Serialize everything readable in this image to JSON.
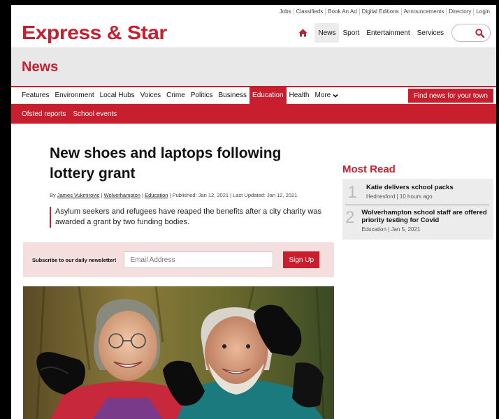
{
  "utility_links": [
    "Jobs",
    "Classifieds",
    "Book An Ad",
    "Digital Editions",
    "Announcements",
    "Directory",
    "Login"
  ],
  "brand": {
    "logo": "Express & Star",
    "accent": "#c91e2e"
  },
  "main_nav": {
    "items": [
      "News",
      "Sport",
      "Entertainment",
      "Services"
    ],
    "active": "News",
    "home_icon": "home-icon",
    "search_icon": "search-icon"
  },
  "section": {
    "title": "News"
  },
  "categories": {
    "items": [
      "Features",
      "Environment",
      "Local Hubs",
      "Voices",
      "Crime",
      "Politics",
      "Business",
      "Education",
      "Health",
      "More"
    ],
    "active": "Education",
    "find_button": "Find news for your town"
  },
  "subnav": [
    "Ofsted reports",
    "School events"
  ],
  "article": {
    "headline": "New shoes and laptops following lottery grant",
    "by": "By",
    "author": "James Vukmirovic",
    "location": "Wolverhampton",
    "category": "Education",
    "published": "Published: Jan 12, 2021",
    "updated": "Last Updated: Jan 12, 2021",
    "lead": "Asylum seekers and refugees have reaped the benefits after a city charity was awarded a grant by two funding bodies."
  },
  "newsletter": {
    "label": "Subscribe to our daily newsletter!",
    "placeholder": "Email Address",
    "button": "Sign Up"
  },
  "most_read": {
    "title": "Most Read",
    "items": [
      {
        "num": "1",
        "headline": "Katie delivers school packs",
        "meta": "Hednesford | 10 hours ago"
      },
      {
        "num": "2",
        "headline": "Wolverhampton school staff are offered priority testing for Covid",
        "meta": "Education | Jan 5, 2021"
      }
    ]
  }
}
